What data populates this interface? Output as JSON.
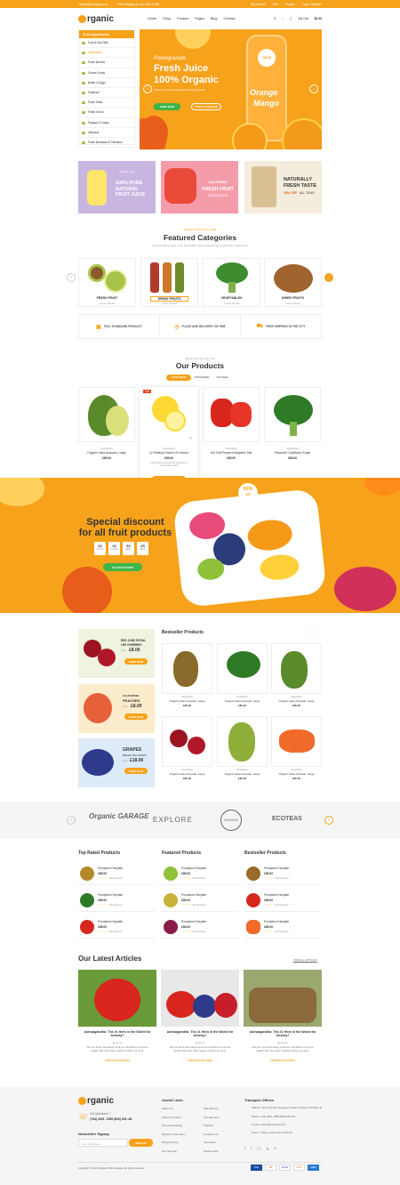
{
  "topbar": {
    "email": "Organic@company.com",
    "ship": "Free Shipping for all Order of $99",
    "account": "My Account",
    "currency": "USD",
    "language": "English",
    "login": "Login / Register"
  },
  "header": {
    "logo": "rganic",
    "nav": [
      "Home",
      "Shop",
      "Product",
      "Pages",
      "Blog",
      "Contact"
    ],
    "cart": "My Cart",
    "cart_total": "$0.00"
  },
  "categories": {
    "title": "All departments",
    "items": [
      "Fruit & Nut Gifts",
      "Vegetables",
      "Fresh Berries",
      "Ocean Foods",
      "Butter & Eggs",
      "Fastfood",
      "Fresh Meat",
      "Fresh Onion",
      "Papaya & Crisps",
      "Oatmeal",
      "Fresh Bananas & Plantains"
    ]
  },
  "hero": {
    "kicker": "Pomegranate",
    "title1": "Fresh Juice",
    "title2": "100% Organic",
    "desc": "A blend of freshly squeezed Orange & Fruit",
    "btn1": "SHOP NOW",
    "btn2": "VIEW LOOKBOOK",
    "bottle_label": "JUICE",
    "bottle_text1": "Orange",
    "bottle_text2": "Mango"
  },
  "promos": [
    {
      "top": "Natural Juice",
      "title1": "100% PURE",
      "title2": "NATURAL",
      "title3": "FRUIT JUICE"
    },
    {
      "top": "CALIFORNIA",
      "title1": "FRESH FRUIT",
      "title2": "ASSOCIATION"
    },
    {
      "title1": "NATURALLY",
      "title2": "FRESH TASTE",
      "sub": "15% OFF",
      "sub2": "ALL TEAS"
    }
  ],
  "featured": {
    "kicker": "FRESH FROM OUR FARM",
    "title": "Featured Categories",
    "desc": "Cultural food is taken from the world's best and fresh farms with strict safety rules",
    "cats": [
      {
        "name": "FRESH FRUIT",
        "sub": "Lorem Ahead"
      },
      {
        "name": "DRINK FRUITS",
        "sub": "Lorem Ahead"
      },
      {
        "name": "VEGETABLES",
        "sub": "Lorem Ahead"
      },
      {
        "name": "DRIED FRUITS",
        "sub": "Lorem Ahead"
      }
    ]
  },
  "features": [
    "FULL STANDARD PRODUCT",
    "PLACE AND DELIVERY ON TIME",
    "FREE SHIPPING IN THE CITY"
  ],
  "products": {
    "kicker": "All the best items for You",
    "title": "Our Products",
    "tabs": [
      "FEATURED",
      "TOP RATED",
      "ON SALE"
    ],
    "items": [
      {
        "cat": "Vegetables",
        "name": "Organic Hass Avocado, Large",
        "price": "£85.00"
      },
      {
        "cat": "Vegetables",
        "name": "12 Healing Powers of Lemons",
        "price": "£85.00",
        "note": "All products are carefully selected to ensure food safety",
        "badge": "-5%",
        "cart": "ADD TO CART"
      },
      {
        "cat": "Vegetables",
        "name": "Hot Chili Peppers Magnetic Salt",
        "price": "£85.00"
      },
      {
        "cat": "Vegetables",
        "name": "Passover Cauliflower Kugel",
        "price": "£85.00"
      }
    ]
  },
  "banner": {
    "title1": "Special discount",
    "title2": "for all fruit products",
    "countdown": [
      {
        "v": "20",
        "l": "DAYS"
      },
      {
        "v": "10",
        "l": "HOURS"
      },
      {
        "v": "60",
        "l": "MINS"
      },
      {
        "v": "25",
        "l": "SECS"
      }
    ],
    "btn": "GO OFFER NOW",
    "badge1": "50%",
    "badge2": "Off"
  },
  "side": [
    {
      "t1": "RED JUNC ROYAL",
      "t2": "LEE CHERRIES",
      "from": "from",
      "price": "£8.00",
      "btn": "SHOP NOW"
    },
    {
      "t1": "CALIFORNIA",
      "t2": "PEACHES",
      "from": "from",
      "price": "£8.00",
      "btn": "SHOP NOW"
    },
    {
      "t1": "GRAPES",
      "t2": "BRAND TEA CRISPS",
      "from": "from",
      "price": "£18.00",
      "btn": "SHOP NOW"
    }
  ],
  "bestseller": {
    "title": "Bestseller Products",
    "items": [
      {
        "cat": "Vegetables",
        "name": "Organic Hass Avocado, Large",
        "price": "£85.00"
      },
      {
        "cat": "Vegetables",
        "name": "Organic Hass Avocado, Large",
        "price": "£85.00"
      },
      {
        "cat": "Vegetables",
        "name": "Organic Hass Avocado, Large",
        "price": "£85.00"
      },
      {
        "cat": "Vegetables",
        "name": "Organic Hass Avocado, Large",
        "price": "£85.00"
      },
      {
        "cat": "Vegetables",
        "name": "Organic Hass Avocado, Large",
        "price": "£85.00"
      },
      {
        "cat": "Vegetables",
        "name": "Organic Hass Avocado, Large",
        "price": "£85.00"
      }
    ]
  },
  "brands": [
    "Organic GARAGE",
    "EXPLORE",
    "ORGANIC",
    "ECOTEAS"
  ],
  "lists": [
    {
      "title": "Top Rated Products",
      "items": [
        {
          "name": "Pumpkins Fairytale",
          "price": "£85.00",
          "rev": "(09 Reviews)"
        },
        {
          "name": "Pumpkins Fairytale",
          "price": "£85.00",
          "rev": "(09 Reviews)"
        },
        {
          "name": "Pumpkins Fairytale",
          "price": "£85.00",
          "rev": "(09 Reviews)"
        }
      ]
    },
    {
      "title": "Featured Products",
      "items": [
        {
          "name": "Pumpkins Fairytale",
          "price": "£85.00",
          "rev": "(09 Reviews)"
        },
        {
          "name": "Pumpkins Fairytale",
          "price": "£85.00",
          "rev": "(09 Reviews)"
        },
        {
          "name": "Pumpkins Fairytale",
          "price": "£85.00",
          "rev": "(09 Reviews)"
        }
      ]
    },
    {
      "title": "Bestseller Products",
      "items": [
        {
          "name": "Pumpkins Fairytale",
          "price": "£85.00",
          "rev": "(09 Reviews)"
        },
        {
          "name": "Pumpkins Fairytale",
          "price": "£85.00",
          "rev": "(09 Reviews)"
        },
        {
          "name": "Pumpkins Fairytale",
          "price": "£85.00",
          "rev": "(09 Reviews)"
        }
      ]
    }
  ],
  "articles": {
    "title": "Our Latest Articles",
    "viewall": "VIEW ALL ARTICLES",
    "items": [
      {
        "t": "Ashwagandha: The #1 Herb in the World for Anxiety?",
        "m": "Admin",
        "d": "Did you know that eating foods are identified to improve health? Eat most often heartily nutrition as clear.",
        "r": "CONTINUE READING"
      },
      {
        "t": "Ashwagandha: The #1 Herb in the World for Anxiety?",
        "m": "Admin",
        "d": "Did you know that eating foods are identified to improve health? Eat most often heartily nutrition as clear.",
        "r": "CONTINUE READING"
      },
      {
        "t": "Ashwagandha: The #1 Herb in the World for Anxiety?",
        "m": "Admin",
        "d": "Did you know that eating foods are identified to improve health? Eat most often heartily nutrition as clear.",
        "r": "CONTINUE READING"
      }
    ]
  },
  "footer": {
    "logo": "rganic",
    "q": "Got Questions ?",
    "phone": "(+84) 3091 -7089 (800) 639 -66",
    "news": "Newsletter Signup",
    "email_ph": "Your email here...",
    "signup": "SIGN UP",
    "links_title": "Useful Links",
    "links1": [
      "About Us",
      "About Our Shop",
      "Secure Shopping",
      "Delivery information",
      "Privacy Policy",
      "Our Sitemap"
    ],
    "links2": [
      "Who We Are",
      "Our Services",
      "Projects",
      "Contacts Us",
      "Innovation",
      "Testimonials"
    ],
    "transport_title": "Transport Offices",
    "addr": "2960 St. Vincent Road, Glasgow, Scotland, Newport NP205, UK",
    "tel": "Phone: (+84) 3091 -7089 (800) 639 -66",
    "mail": "E-mail: contact@company.com",
    "hours": "Hours: 7 Days a week from 10:00 am",
    "copy": "Copyright © 2018 Organic PSD template. All rights reserved",
    "pay": [
      "VISA",
      "MC",
      "PayPal",
      "DISC",
      "AMEX"
    ]
  }
}
